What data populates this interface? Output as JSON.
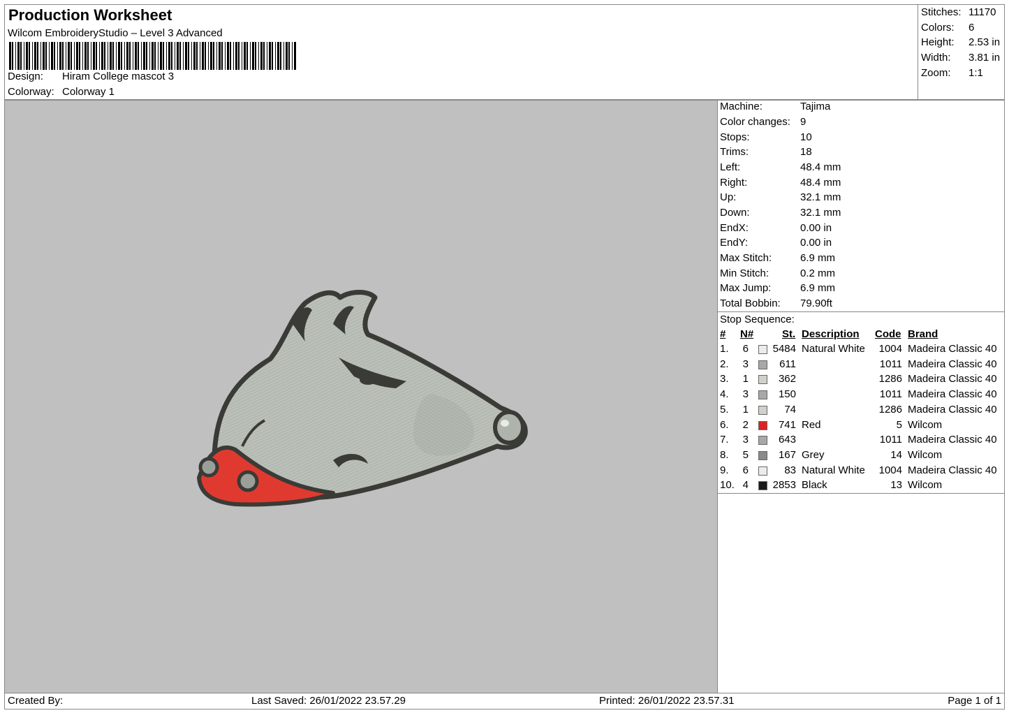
{
  "header": {
    "title": "Production Worksheet",
    "software": "Wilcom EmbroideryStudio – Level 3 Advanced",
    "design_label": "Design:",
    "design_value": "Hiram College mascot 3",
    "colorway_label": "Colorway:",
    "colorway_value": "Colorway 1"
  },
  "summary": [
    {
      "label": "Stitches:",
      "value": "11170"
    },
    {
      "label": "Colors:",
      "value": "6"
    },
    {
      "label": "Height:",
      "value": "2.53 in"
    },
    {
      "label": "Width:",
      "value": "3.81 in"
    },
    {
      "label": "Zoom:",
      "value": "1:1"
    }
  ],
  "machine": [
    {
      "label": "Machine:",
      "value": "Tajima"
    },
    {
      "label": "Color changes:",
      "value": "9"
    },
    {
      "label": "Stops:",
      "value": "10"
    },
    {
      "label": "Trims:",
      "value": "18"
    },
    {
      "label": "Left:",
      "value": "48.4 mm"
    },
    {
      "label": "Right:",
      "value": "48.4 mm"
    },
    {
      "label": "Up:",
      "value": "32.1 mm"
    },
    {
      "label": "Down:",
      "value": "32.1 mm"
    },
    {
      "label": "EndX:",
      "value": "0.00 in"
    },
    {
      "label": "EndY:",
      "value": "0.00 in"
    },
    {
      "label": "Max Stitch:",
      "value": "6.9 mm"
    },
    {
      "label": "Min Stitch:",
      "value": "0.2 mm"
    },
    {
      "label": "Max Jump:",
      "value": "6.9 mm"
    },
    {
      "label": "Total Bobbin:",
      "value": "79.90ft"
    }
  ],
  "stop_sequence": {
    "title": "Stop Sequence:",
    "headers": {
      "idx": "#",
      "n": "N#",
      "st": "St.",
      "desc": "Description",
      "code": "Code",
      "brand": "Brand"
    },
    "rows": [
      {
        "idx": "1.",
        "n": "6",
        "color": "#ececec",
        "st": "5484",
        "desc": "Natural White",
        "code": "1004",
        "brand": "Madeira Classic 40"
      },
      {
        "idx": "2.",
        "n": "3",
        "color": "#a8a8a8",
        "st": "611",
        "desc": "",
        "code": "1011",
        "brand": "Madeira Classic 40"
      },
      {
        "idx": "3.",
        "n": "1",
        "color": "#d2d0cc",
        "st": "362",
        "desc": "",
        "code": "1286",
        "brand": "Madeira Classic 40"
      },
      {
        "idx": "4.",
        "n": "3",
        "color": "#a8a8a8",
        "st": "150",
        "desc": "",
        "code": "1011",
        "brand": "Madeira Classic 40"
      },
      {
        "idx": "5.",
        "n": "1",
        "color": "#d2d0cc",
        "st": "74",
        "desc": "",
        "code": "1286",
        "brand": "Madeira Classic 40"
      },
      {
        "idx": "6.",
        "n": "2",
        "color": "#e02020",
        "st": "741",
        "desc": "Red",
        "code": "5",
        "brand": "Wilcom"
      },
      {
        "idx": "7.",
        "n": "3",
        "color": "#a8a8a8",
        "st": "643",
        "desc": "",
        "code": "1011",
        "brand": "Madeira Classic 40"
      },
      {
        "idx": "8.",
        "n": "5",
        "color": "#8a8a8a",
        "st": "167",
        "desc": "Grey",
        "code": "14",
        "brand": "Wilcom"
      },
      {
        "idx": "9.",
        "n": "6",
        "color": "#ececec",
        "st": "83",
        "desc": "Natural White",
        "code": "1004",
        "brand": "Madeira Classic 40"
      },
      {
        "idx": "10.",
        "n": "4",
        "color": "#1a1a1a",
        "st": "2853",
        "desc": "Black",
        "code": "13",
        "brand": "Wilcom"
      }
    ]
  },
  "footer": {
    "created_by": "Created By:",
    "last_saved": "Last Saved: 26/01/2022 23.57.29",
    "printed": "Printed: 26/01/2022 23.57.31",
    "page": "Page 1 of 1"
  },
  "colors": {
    "preview_bg": "#c0c0c0",
    "dog_fill": "#b4bab2",
    "outline": "#3a3a36",
    "collar": "#e03a30"
  }
}
